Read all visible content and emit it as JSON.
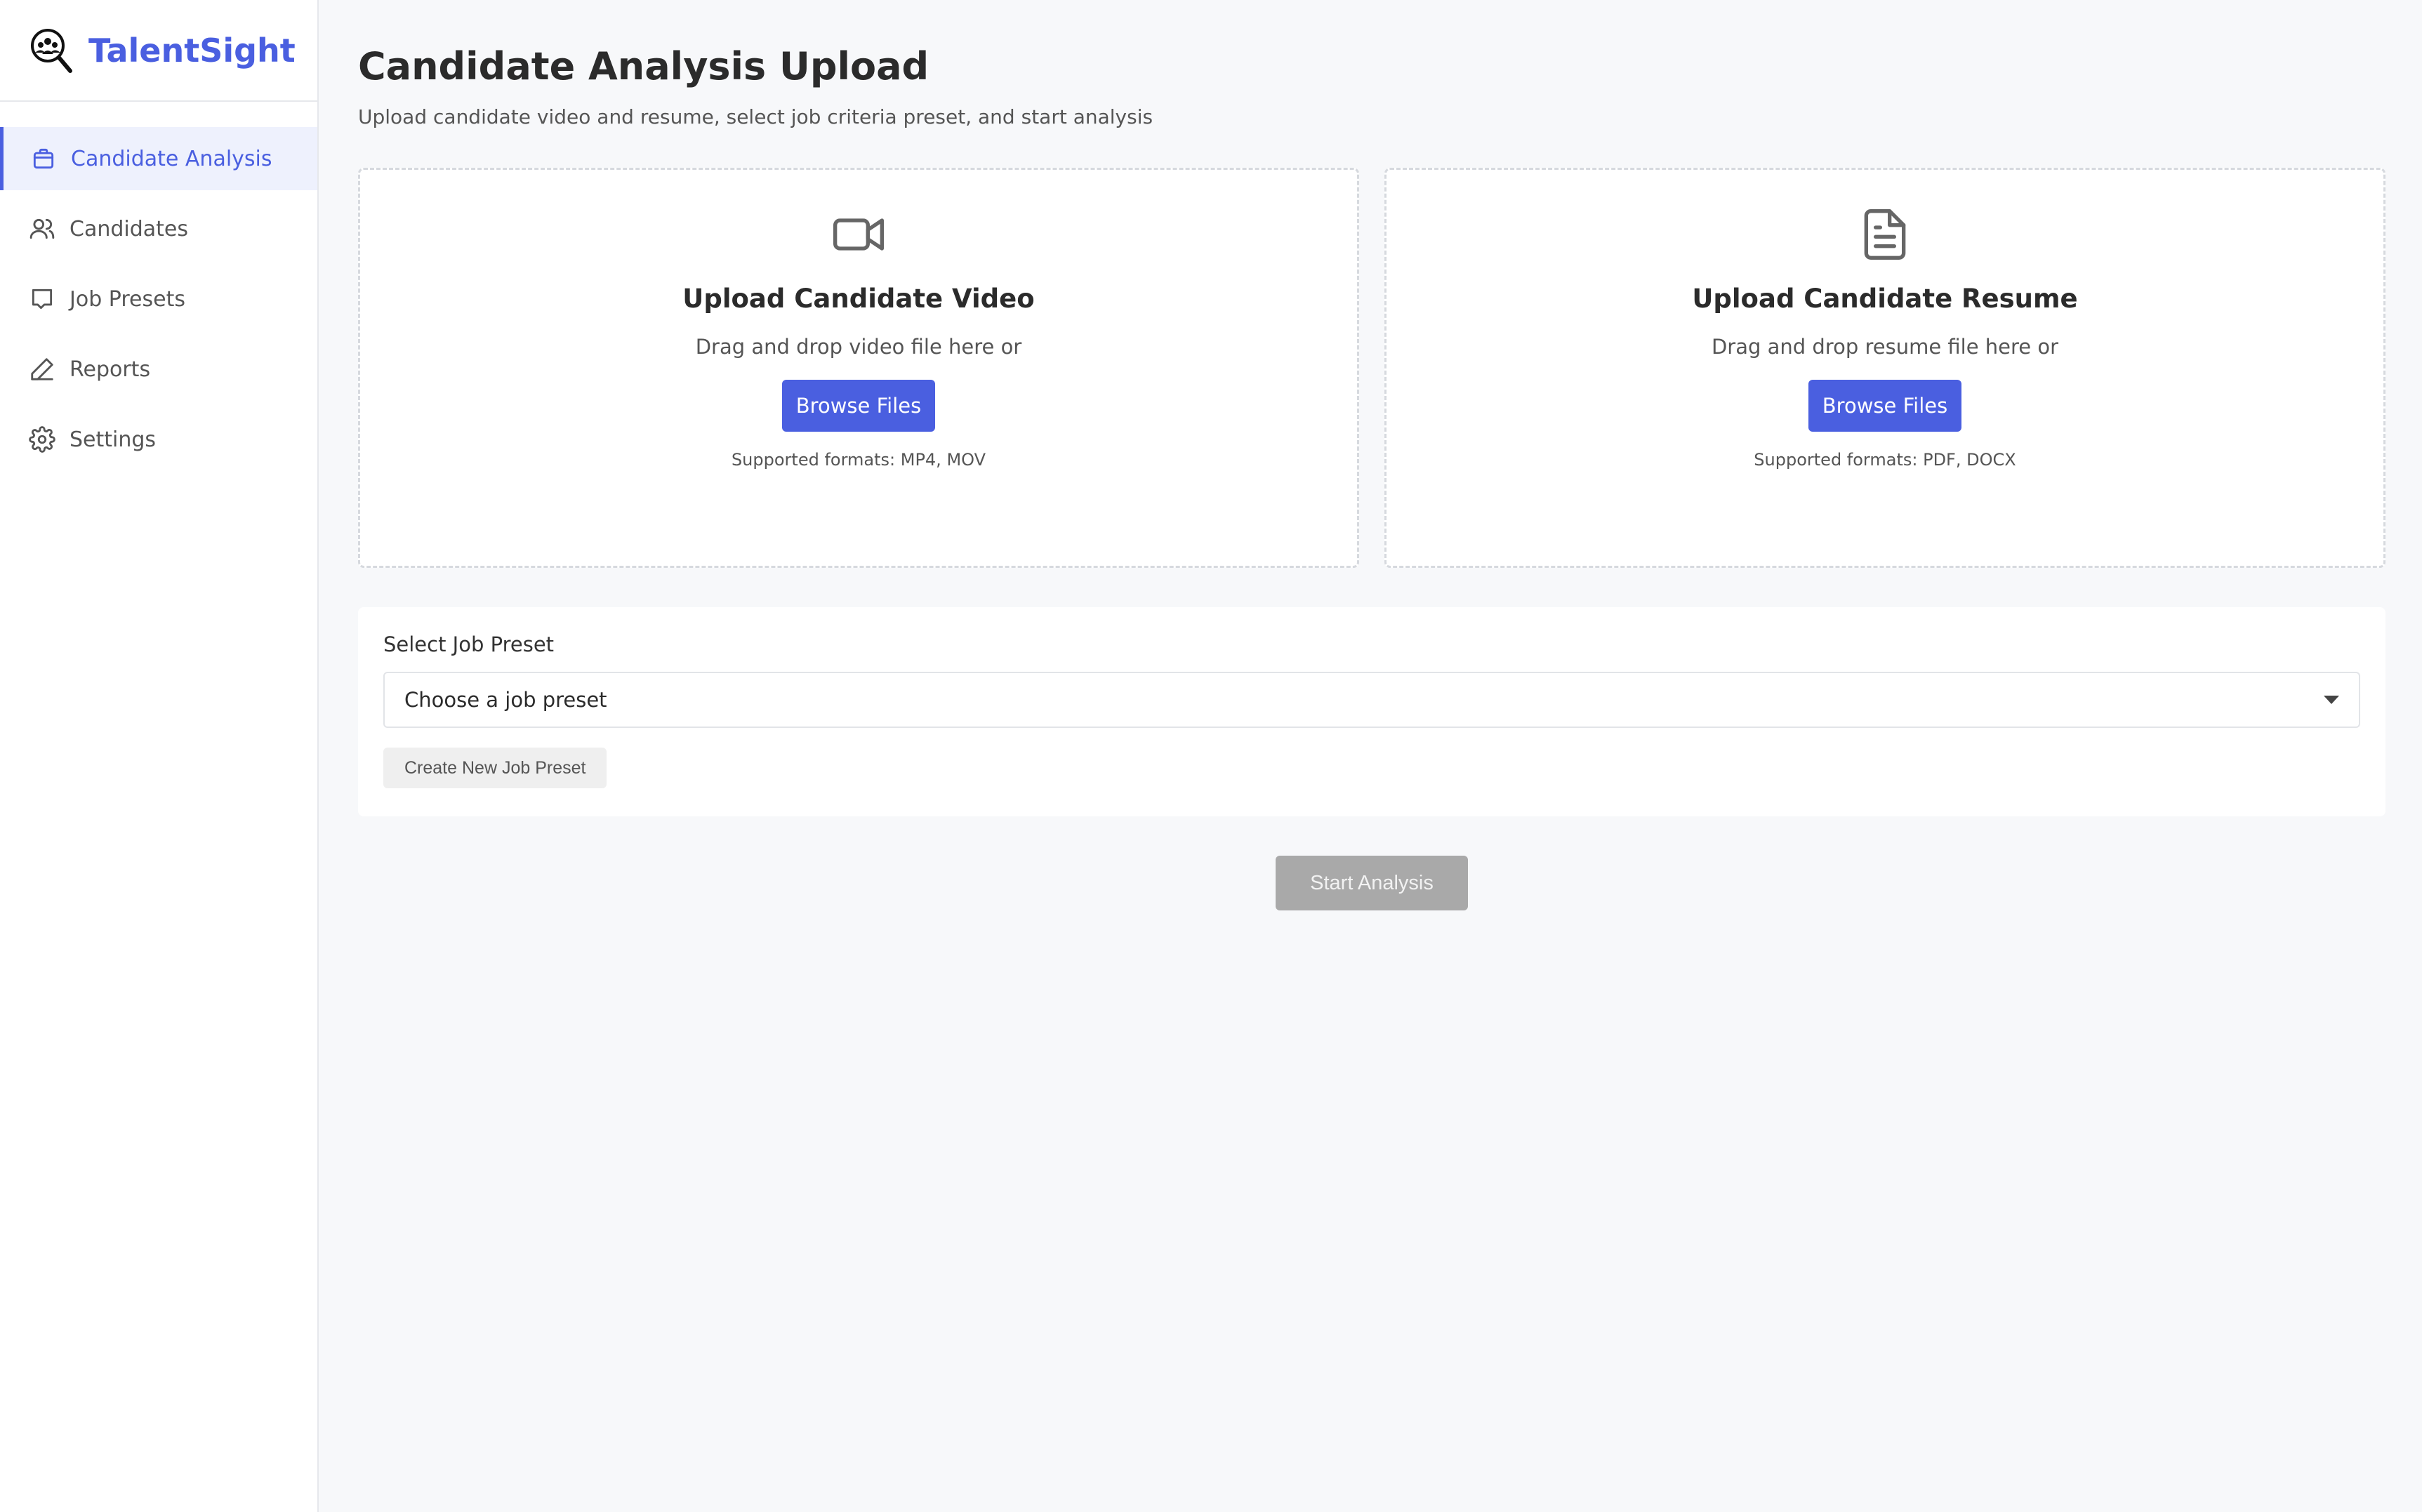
{
  "brand": {
    "name": "TalentSight",
    "icon": "magnifier-people-icon",
    "color": "#4a5fe0"
  },
  "sidebar": {
    "items": [
      {
        "label": "Candidate Analysis",
        "icon": "briefcase-icon",
        "active": true
      },
      {
        "label": "Candidates",
        "icon": "users-icon",
        "active": false
      },
      {
        "label": "Job Presets",
        "icon": "message-square-icon",
        "active": false
      },
      {
        "label": "Reports",
        "icon": "pen-icon",
        "active": false
      },
      {
        "label": "Settings",
        "icon": "gear-icon",
        "active": false
      }
    ]
  },
  "main": {
    "title": "Candidate Analysis Upload",
    "subtitle": "Upload candidate video and resume, select job criteria preset, and start analysis",
    "uploads": [
      {
        "icon": "video-camera-icon",
        "title": "Upload Candidate Video",
        "hint": "Drag and drop video file here or",
        "button": "Browse Files",
        "formats": "Supported formats: MP4, MOV"
      },
      {
        "icon": "document-icon",
        "title": "Upload Candidate Resume",
        "hint": "Drag and drop resume file here or",
        "button": "Browse Files",
        "formats": "Supported formats: PDF, DOCX"
      }
    ],
    "preset": {
      "label": "Select Job Preset",
      "selected": "Choose a job preset",
      "create_button": "Create New Job Preset"
    },
    "start_button": "Start Analysis"
  },
  "colors": {
    "accent": "#4a5fe0",
    "disabled": "#a9a9a9"
  }
}
